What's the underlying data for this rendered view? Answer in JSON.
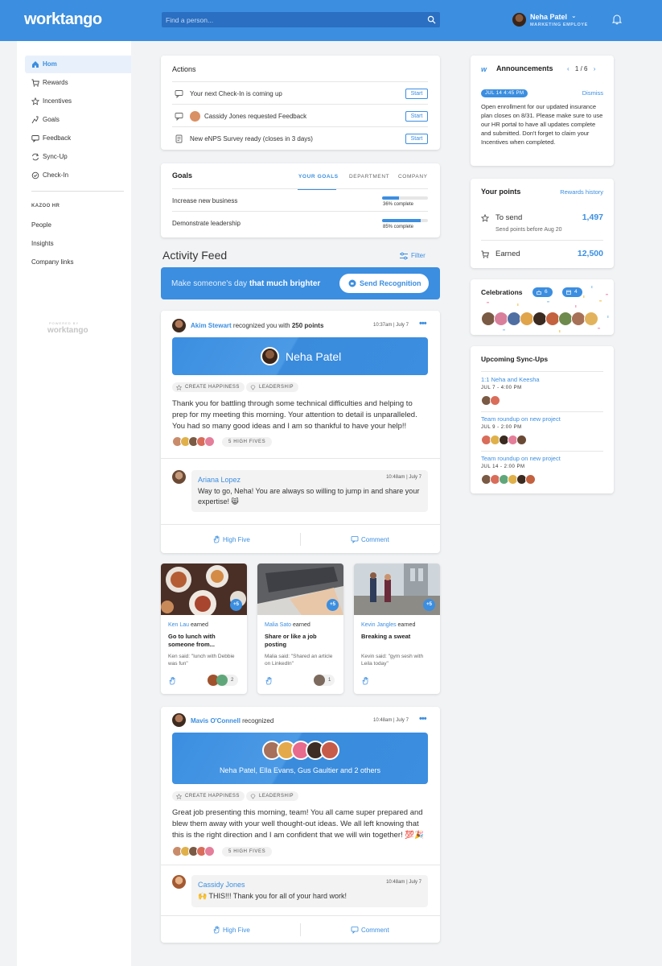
{
  "topbar": {
    "logo": "worktango",
    "search_placeholder": "Find a person...",
    "user_name": "Neha Patel",
    "user_role": "MARKETING EMPLOYE"
  },
  "sidebar": {
    "items": [
      {
        "label": "Hom",
        "icon": "home-icon",
        "active": true
      },
      {
        "label": "Rewards",
        "icon": "cart-icon"
      },
      {
        "label": "Incentives",
        "icon": "star-icon"
      },
      {
        "label": "Goals",
        "icon": "goals-icon"
      },
      {
        "label": "Feedback",
        "icon": "feedback-icon"
      },
      {
        "label": "Sync-Up",
        "icon": "sync-icon"
      },
      {
        "label": "Check-In",
        "icon": "checkin-icon"
      }
    ],
    "section": "KAZOO HR",
    "links": [
      "People",
      "Insights",
      "Company links"
    ],
    "powered_by": "POWERED BY",
    "powered_logo": "worktango"
  },
  "actions": {
    "title": "Actions",
    "rows": [
      {
        "text": "Your next Check-In is coming up",
        "button": "Start"
      },
      {
        "text": "Cassidy Jones requested Feedback",
        "button": "Start"
      },
      {
        "text": "New eNPS Survey ready (closes in 3 days)",
        "button": "Start"
      }
    ]
  },
  "goals": {
    "title": "Goals",
    "tabs": [
      "YOUR GOALS",
      "DEPARTMENT",
      "COMPANY"
    ],
    "rows": [
      {
        "name": "Increase new business",
        "progress": 0.36,
        "label": "36% complete"
      },
      {
        "name": "Demonstrate leadership",
        "progress": 0.85,
        "label": "85% complete"
      }
    ]
  },
  "feed": {
    "title": "Activity Feed",
    "filter": "Filter",
    "banner_plain": "Make someone's day ",
    "banner_bold": "that much brighter",
    "send_button": "Send Recognition"
  },
  "post1": {
    "author": "Akim Stewart",
    "verb": " recognized you with ",
    "points": "250 points",
    "time": "10:37am | July 7",
    "recipient": "Neha Patel",
    "tags": [
      "CREATE HAPPINESS",
      "LEADERSHIP"
    ],
    "body": "Thank you for battling through some technical difficulties and helping to prep for my meeting this morning. Your attention to detail is unparalleled. You had so many good ideas and I am so thankful to have your help!!",
    "high_fives": "5 HIGH FIVES",
    "comment": {
      "name": "Ariana Lopez",
      "time": "10:48am | July 7",
      "text": "Way to go, Neha! You are always so willing to jump in and share your expertise! 😸"
    },
    "high_five_btn": "High Five",
    "comment_btn": "Comment"
  },
  "incentives": [
    {
      "name": "Ken Lau",
      "verb": " earned",
      "title": "Go to lunch with someone from...",
      "said": "Ken said: \"lunch with Debbie was fun\"",
      "plus": "+5",
      "count": "2"
    },
    {
      "name": "Malia Sato",
      "verb": " earned",
      "title": "Share or like a job posting",
      "said": "Malia said: \"Shared an article on LinkedIn\"",
      "plus": "+5",
      "count": "1"
    },
    {
      "name": "Kevin Jangles",
      "verb": " earned",
      "title": "Breaking a sweat",
      "said": "Kevin said: \"gym sesh with Leila today\"",
      "plus": "+5",
      "count": ""
    }
  ],
  "post2": {
    "author": "Mavis O'Connell",
    "verb": " recognized",
    "time": "10:48am | July 7",
    "recipients": "Neha Patel, Ella Evans, Gus Gaultier and 2 others",
    "tags": [
      "CREATE HAPPINESS",
      "LEADERSHIP"
    ],
    "body": "Great job presenting this morning, team! You all came super prepared and blew them away with your well thought-out ideas. We all left knowing that this is the right direction and I am confident that we will win together! 💯🎉",
    "high_fives": "5 HIGH FIVES",
    "comment": {
      "name": "Cassidy Jones",
      "time": "10:48am | July 7",
      "text": "🙌 THIS!!!  Thank you for all of your hard work!"
    },
    "high_five_btn": "High Five",
    "comment_btn": "Comment"
  },
  "announcements": {
    "logo": "w",
    "title": "Announcements",
    "pager": "1 / 6",
    "date": "JUL 14 4:45 PM",
    "dismiss": "Dismiss",
    "body": "Open enrollment for our updated insurance plan closes on 8/31. Please make sure to use our HR portal to have all updates complete and submitted. Don't forget to claim your Incentives when completed."
  },
  "points": {
    "title": "Your points",
    "history": "Rewards history",
    "to_send_label": "To send",
    "to_send": "1,497",
    "to_send_sub": "Send points before Aug 20",
    "earned_label": "Earned",
    "earned": "12,500"
  },
  "celebrations": {
    "title": "Celebrations",
    "birthdays": "6",
    "anniversaries": "4"
  },
  "syncups": {
    "title": "Upcoming Sync-Ups",
    "items": [
      {
        "name": "1:1 Neha and Keesha",
        "date": "JUL 7 - 4:00 PM"
      },
      {
        "name": "Team roundup on new project",
        "date": "JUL 9 - 2:00 PM"
      },
      {
        "name": "Team roundup on new project",
        "date": "JUL 14 - 2:00 PM"
      }
    ]
  },
  "colors": {
    "accent": "#3b8ee0",
    "background": "#f2f3f5"
  }
}
